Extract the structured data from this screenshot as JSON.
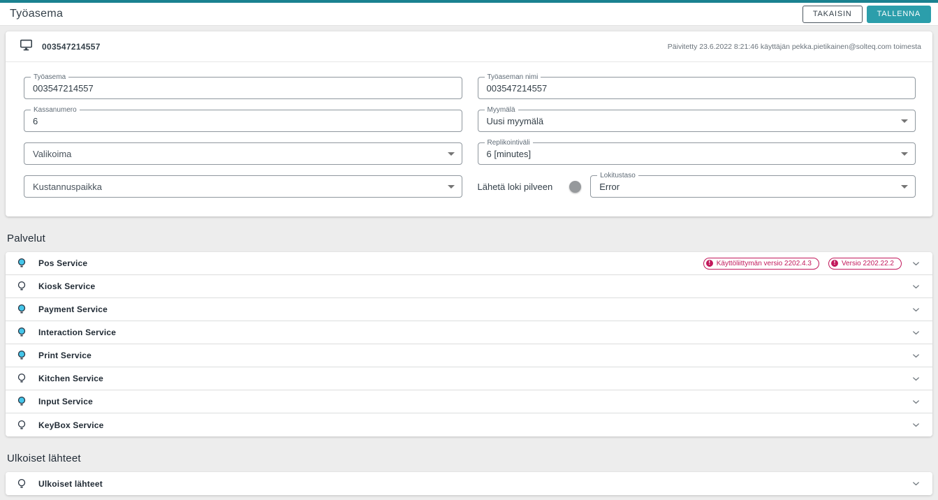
{
  "colors": {
    "top_strip": "#1b8290",
    "accent": "#2b9eab",
    "badge": "#c2185b",
    "bulb_on": "#45c6ea",
    "bulb_outline": "#26313f"
  },
  "header": {
    "title": "Työasema",
    "back_label": "TAKAISIN",
    "save_label": "TALLENNA"
  },
  "workstation": {
    "id": "003547214557",
    "updated_text": "Päivitetty 23.6.2022 8:21:46 käyttäjän pekka.pietikainen@solteq.com toimesta"
  },
  "form": {
    "tyoasema": {
      "label": "Työasema",
      "value": "003547214557"
    },
    "tyoaseman_nimi": {
      "label": "Työaseman nimi",
      "value": "003547214557"
    },
    "kassanumero": {
      "label": "Kassanumero",
      "value": "6"
    },
    "myymala": {
      "label": "Myymälä",
      "value": "Uusi myymälä"
    },
    "valikoima": {
      "label": "Valikoima",
      "value": ""
    },
    "replikointivali": {
      "label": "Replikointiväli",
      "value": "6 [minutes]"
    },
    "kustannuspaikka": {
      "label": "Kustannuspaikka",
      "value": ""
    },
    "laheta_loki_pilveen": {
      "label": "Lähetä loki pilveen",
      "enabled": false
    },
    "lokitustaso": {
      "label": "Lokitustaso",
      "value": "Error"
    }
  },
  "sections": {
    "palvelut": {
      "title": "Palvelut",
      "services": [
        {
          "name": "Pos Service",
          "enabled": true,
          "badges": [
            "Käyttöliittymän versio 2202.4.3",
            "Versio 2202.22.2"
          ]
        },
        {
          "name": "Kiosk Service",
          "enabled": false,
          "badges": []
        },
        {
          "name": "Payment Service",
          "enabled": true,
          "badges": []
        },
        {
          "name": "Interaction Service",
          "enabled": true,
          "badges": []
        },
        {
          "name": "Print Service",
          "enabled": true,
          "badges": []
        },
        {
          "name": "Kitchen Service",
          "enabled": false,
          "badges": []
        },
        {
          "name": "Input Service",
          "enabled": true,
          "badges": []
        },
        {
          "name": "KeyBox Service",
          "enabled": false,
          "badges": []
        }
      ]
    },
    "ulkoiset": {
      "title": "Ulkoiset lähteet",
      "services": [
        {
          "name": "Ulkoiset lähteet",
          "enabled": false,
          "badges": []
        }
      ]
    }
  }
}
